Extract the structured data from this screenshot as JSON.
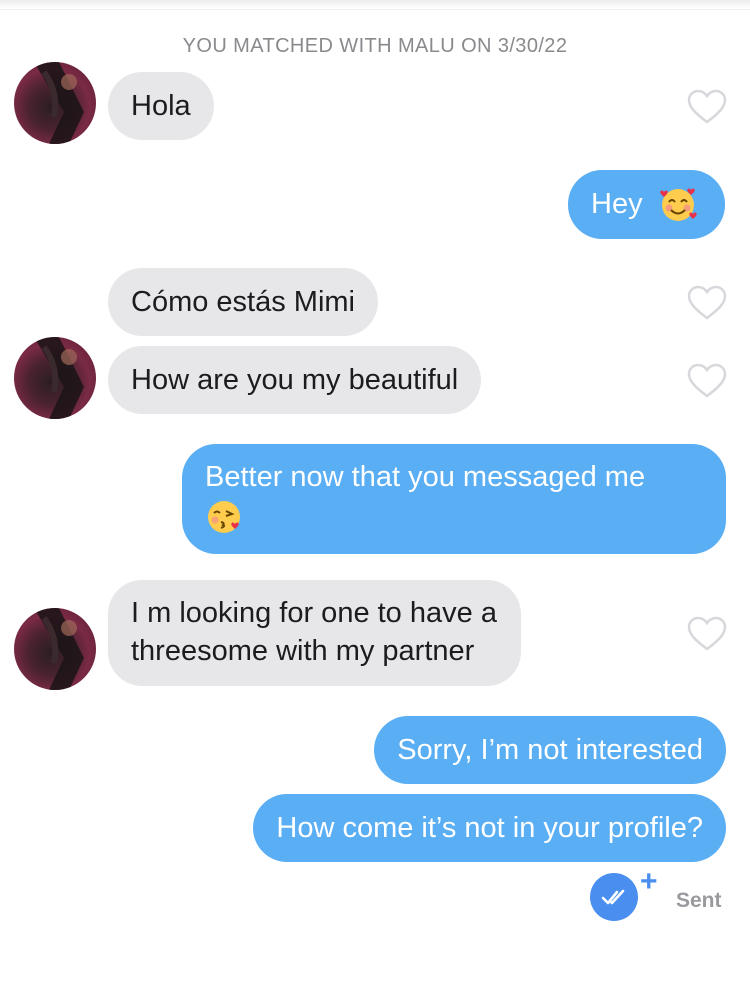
{
  "match_banner": "YOU MATCHED WITH MALU ON 3/30/22",
  "messages": [
    {
      "from": "them",
      "text": "Hola"
    },
    {
      "from": "me",
      "text": "Hey",
      "emoji": "smiling-face-with-hearts"
    },
    {
      "from": "them",
      "text": "Cómo estás Mimi"
    },
    {
      "from": "them",
      "text": "How are you my beautiful"
    },
    {
      "from": "me",
      "text": "Better now that you messaged me",
      "emoji": "kissing-face"
    },
    {
      "from": "them",
      "line1": "I m looking for one to have a",
      "line2": "threesome with my partner"
    },
    {
      "from": "me",
      "text": "Sorry, I’m not interested"
    },
    {
      "from": "me",
      "text": "How come it’s not in your profile?"
    }
  ],
  "status": {
    "label": "Sent",
    "plus": "+",
    "icon": "double-check-icon"
  },
  "colors": {
    "outgoing_bubble": "#5aaef3",
    "incoming_bubble": "#e7e7ea",
    "read_icon": "#4a8ef0"
  }
}
